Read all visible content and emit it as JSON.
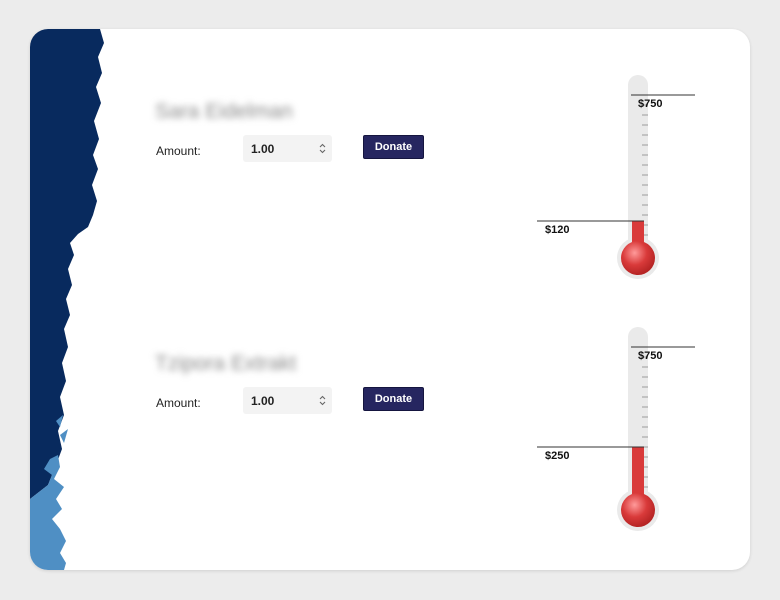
{
  "campaigns": [
    {
      "name": "Sara Eidelman",
      "amount_label": "Amount:",
      "amount_value": "1.00",
      "donate_label": "Donate",
      "goal_label": "$750",
      "raised_label": "$120",
      "goal_amount": 750,
      "raised_amount": 120
    },
    {
      "name": "Tzipora Extrakt",
      "amount_label": "Amount:",
      "amount_value": "1.00",
      "donate_label": "Donate",
      "goal_label": "$750",
      "raised_label": "$250",
      "goal_amount": 750,
      "raised_amount": 250
    }
  ],
  "colors": {
    "page_background": "#ececec",
    "card_background": "#ffffff",
    "navy_art": "#082a5e",
    "light_blue_art": "#4f8fc4",
    "button": "#262660",
    "mercury": "#d93a3a",
    "tube": "#eaeaea"
  }
}
